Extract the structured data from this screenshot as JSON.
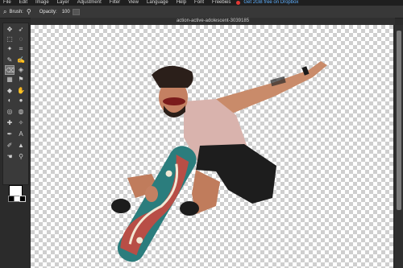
{
  "menu": {
    "items": [
      "File",
      "Edit",
      "Image",
      "Layer",
      "Adjustment",
      "Filter",
      "View",
      "Language",
      "Help",
      "Font",
      "Freebies"
    ],
    "promo": "Get 2GB free on Dropbox"
  },
  "options": {
    "brush_label": "Brush:",
    "opacity_label": "Opacity:",
    "opacity_value": "100"
  },
  "document": {
    "title": "action-active-adolescent-3039185"
  },
  "colors": {
    "foreground": "#ffffff",
    "background": "#000000"
  }
}
